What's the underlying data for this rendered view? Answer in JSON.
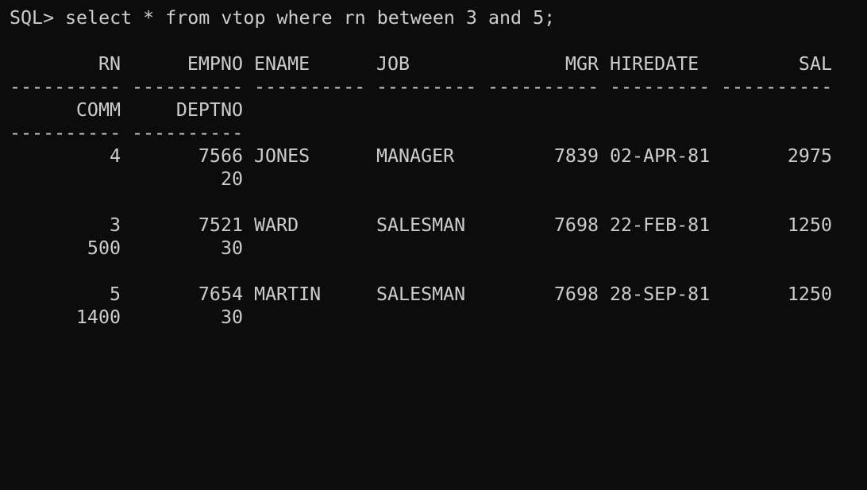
{
  "terminal": {
    "prompt": "SQL>",
    "command": "select * from vtop where rn between 3 and 5;",
    "headers": {
      "rn": "RN",
      "empno": "EMPNO",
      "ename": "ENAME",
      "job": "JOB",
      "mgr": "MGR",
      "hiredate": "HIREDATE",
      "sal": "SAL",
      "comm": "COMM",
      "deptno": "DEPTNO"
    },
    "separator": {
      "ten": "----------",
      "nine": "---------"
    },
    "rows": [
      {
        "rn": "4",
        "empno": "7566",
        "ename": "JONES",
        "job": "MANAGER",
        "mgr": "7839",
        "hiredate": "02-APR-81",
        "sal": "2975",
        "comm": "",
        "deptno": "20"
      },
      {
        "rn": "3",
        "empno": "7521",
        "ename": "WARD",
        "job": "SALESMAN",
        "mgr": "7698",
        "hiredate": "22-FEB-81",
        "sal": "1250",
        "comm": "500",
        "deptno": "30"
      },
      {
        "rn": "5",
        "empno": "7654",
        "ename": "MARTIN",
        "job": "SALESMAN",
        "mgr": "7698",
        "hiredate": "28-SEP-81",
        "sal": "1250",
        "comm": "1400",
        "deptno": "30"
      }
    ]
  }
}
